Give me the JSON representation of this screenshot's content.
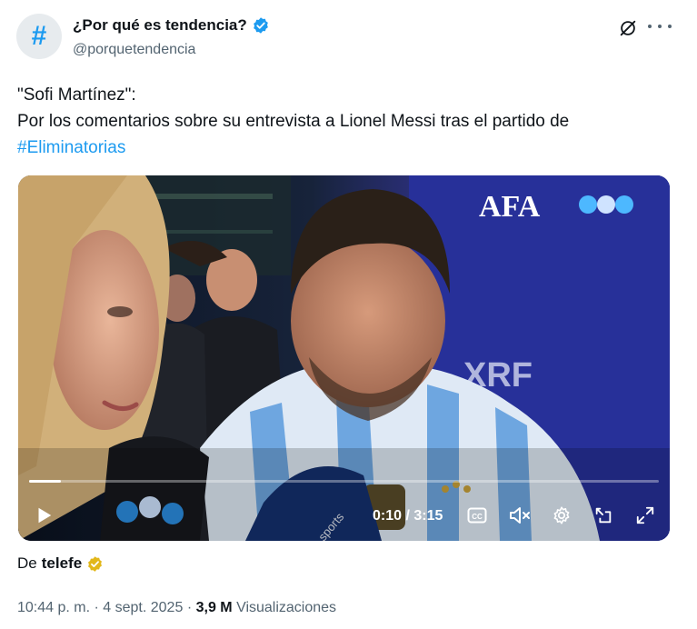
{
  "account": {
    "display_name": "¿Por qué es tendencia?",
    "handle": "@porquetendencia",
    "avatar_symbol": "#",
    "verified": true
  },
  "tweet": {
    "line1": "\"Sofi Martínez\":",
    "line2": "Por los comentarios sobre su entrevista a Lionel Messi tras el partido de",
    "hashtag": "#Eliminatorias"
  },
  "video": {
    "overlay_logo": "AFA",
    "backdrop_text": "XRF",
    "mic_text": "sports",
    "current_time": "0:10",
    "duration": "3:15",
    "time_display": "0:10 / 3:15",
    "progress_fraction": 0.05,
    "controls": [
      "play-icon",
      "captions-icon",
      "mute-icon",
      "settings-icon",
      "pip-icon",
      "fullscreen-icon"
    ],
    "captions_label": "CC"
  },
  "source": {
    "prefix": "De",
    "name": "telefe"
  },
  "meta": {
    "time": "10:44 p. m.",
    "separator": "·",
    "date": "4 sept. 2025",
    "views_count": "3,9 M",
    "views_label": "Visualizaciones"
  },
  "colors": {
    "accent": "#1d9bf0",
    "gold_badge": "#e2b719",
    "secondary_text": "#536471"
  }
}
